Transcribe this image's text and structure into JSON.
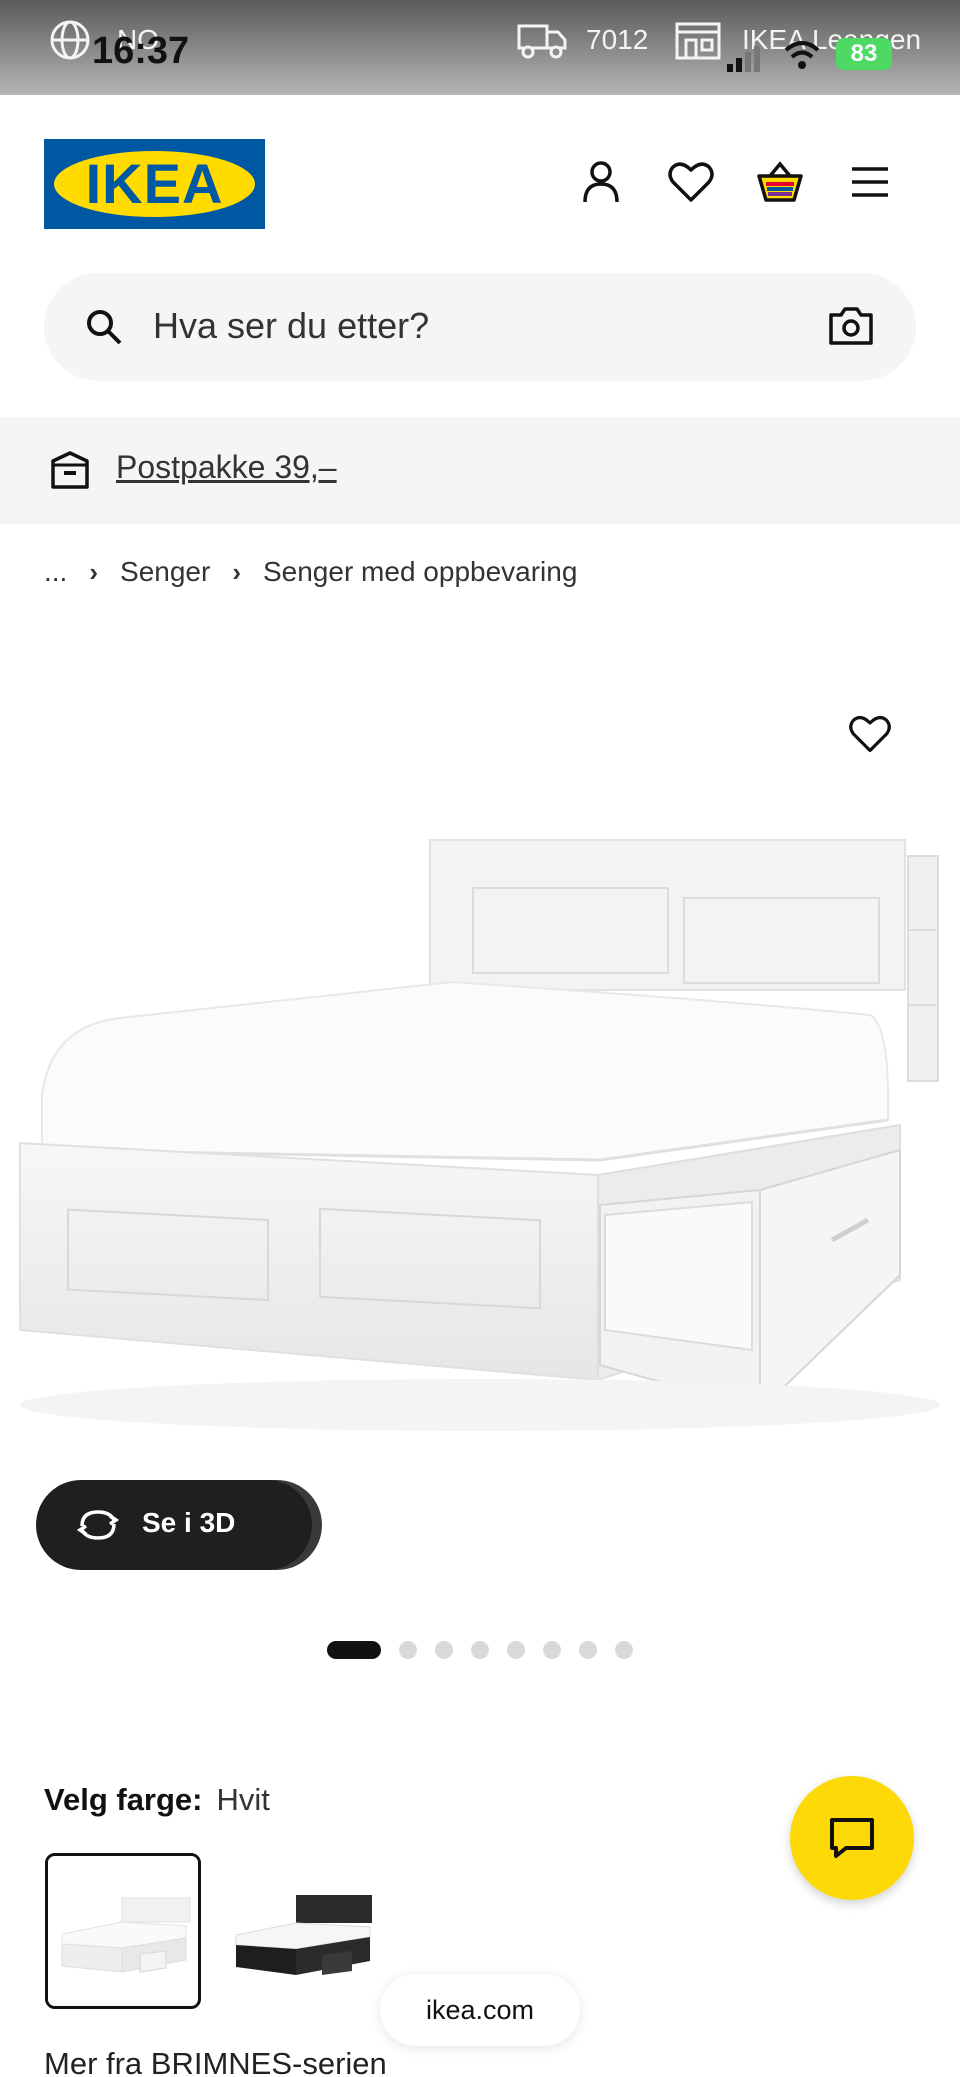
{
  "status_bar": {
    "region": "NO",
    "time": "16:37",
    "postal_code": "7012",
    "store": "IKEA Leangen",
    "battery": "83"
  },
  "header": {
    "logo_text": "IKEA",
    "icons": [
      "user-icon",
      "heart-icon",
      "basket-icon",
      "menu-icon"
    ]
  },
  "search": {
    "placeholder": "Hva ser du etter?"
  },
  "banner": {
    "text": "Postpakke 39,–"
  },
  "breadcrumb": {
    "ellipsis": "...",
    "items": [
      "Senger",
      "Senger med oppbevaring"
    ]
  },
  "gallery": {
    "view3d_label": "Se i 3D",
    "total_images": 8,
    "active_index": 0
  },
  "color": {
    "label": "Velg farge:",
    "selected": "Hvit",
    "options": [
      "white",
      "black-brown"
    ]
  },
  "browser": {
    "url": "ikea.com"
  },
  "series": {
    "text": "Mer fra BRIMNES-serien"
  },
  "colors": {
    "ikea_blue": "#0058a3",
    "ikea_yellow": "#ffdb00",
    "chat_yellow": "#fdd908",
    "battery_green": "#4cd964"
  }
}
